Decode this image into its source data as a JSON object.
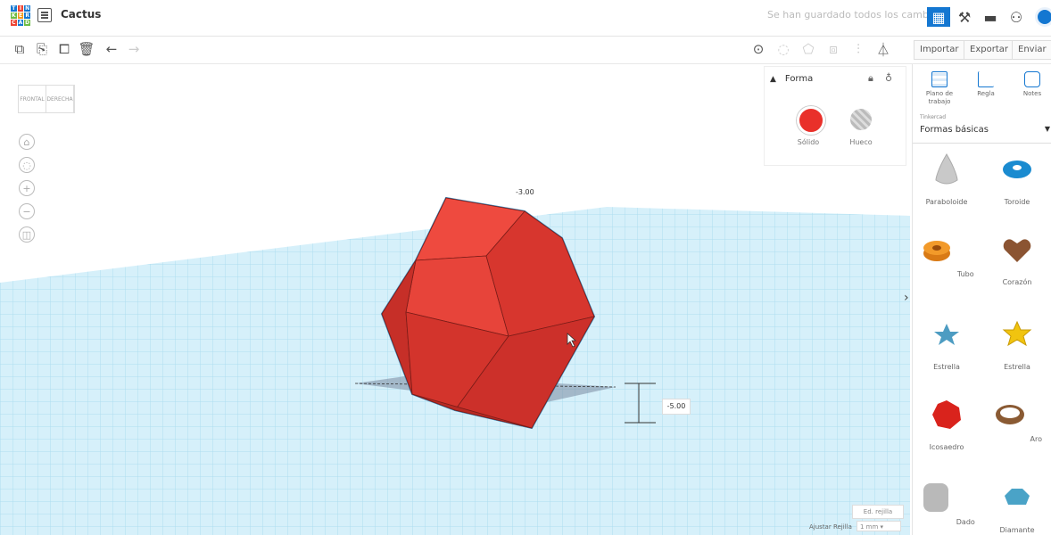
{
  "app": {
    "title": "Cactus",
    "saved_status": "Se han guardado todos los cambios."
  },
  "toolbar": {
    "import_label": "Importar",
    "export_label": "Exportar",
    "send_label": "Enviar a"
  },
  "viewcube": {
    "front_label": "FRONTAL",
    "right_label": "DERECHA"
  },
  "shape_panel": {
    "title": "Forma",
    "solid_label": "Sólido",
    "hole_label": "Hueco",
    "solid_color": "#e9302a"
  },
  "dimensions": {
    "top_value": "-3.00",
    "height_value": "-5.00"
  },
  "grid": {
    "edit_label": "Ed. rejilla",
    "snap_label": "Ajustar Rejilla",
    "snap_value": "1 mm"
  },
  "sidebar": {
    "tools": [
      {
        "label": "Plano de trabajo"
      },
      {
        "label": "Regla"
      },
      {
        "label": "Notes"
      }
    ],
    "source": "Tinkercad",
    "library": "Formas básicas",
    "items": [
      {
        "label": "Paraboloide"
      },
      {
        "label": "Toroide"
      },
      {
        "label": "Tubo"
      },
      {
        "label": "Corazón"
      },
      {
        "label": "Estrella"
      },
      {
        "label": "Estrella"
      },
      {
        "label": "Icosaedro"
      },
      {
        "label": "Aro"
      },
      {
        "label": "Dado"
      },
      {
        "label": "Diamante"
      }
    ]
  },
  "colors": {
    "accent": "#1477d1",
    "shape_red": "#e9302a",
    "grid_blue": "#9ed4ea"
  }
}
